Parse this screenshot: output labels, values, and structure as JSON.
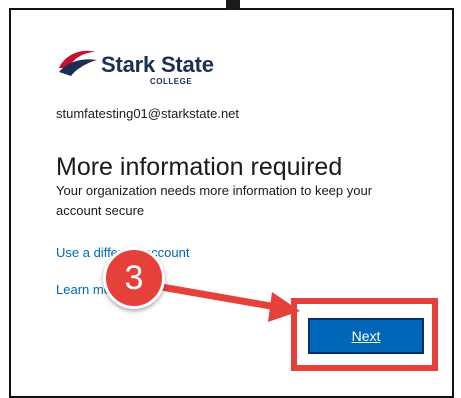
{
  "logo": {
    "name": "Stark State",
    "sub": "COLLEGE"
  },
  "identity": "stumfatesting01@starkstate.net",
  "title": "More information required",
  "description": "Your organization needs more information to keep your account secure",
  "links": {
    "different_account": "Use a different account",
    "learn_more": "Learn more"
  },
  "next_label": "Next",
  "annotation": {
    "step": "3",
    "color": "#e5403a"
  },
  "colors": {
    "accent": "#0067b8",
    "brand_navy": "#1c2e52",
    "brand_red": "#c8102e"
  }
}
